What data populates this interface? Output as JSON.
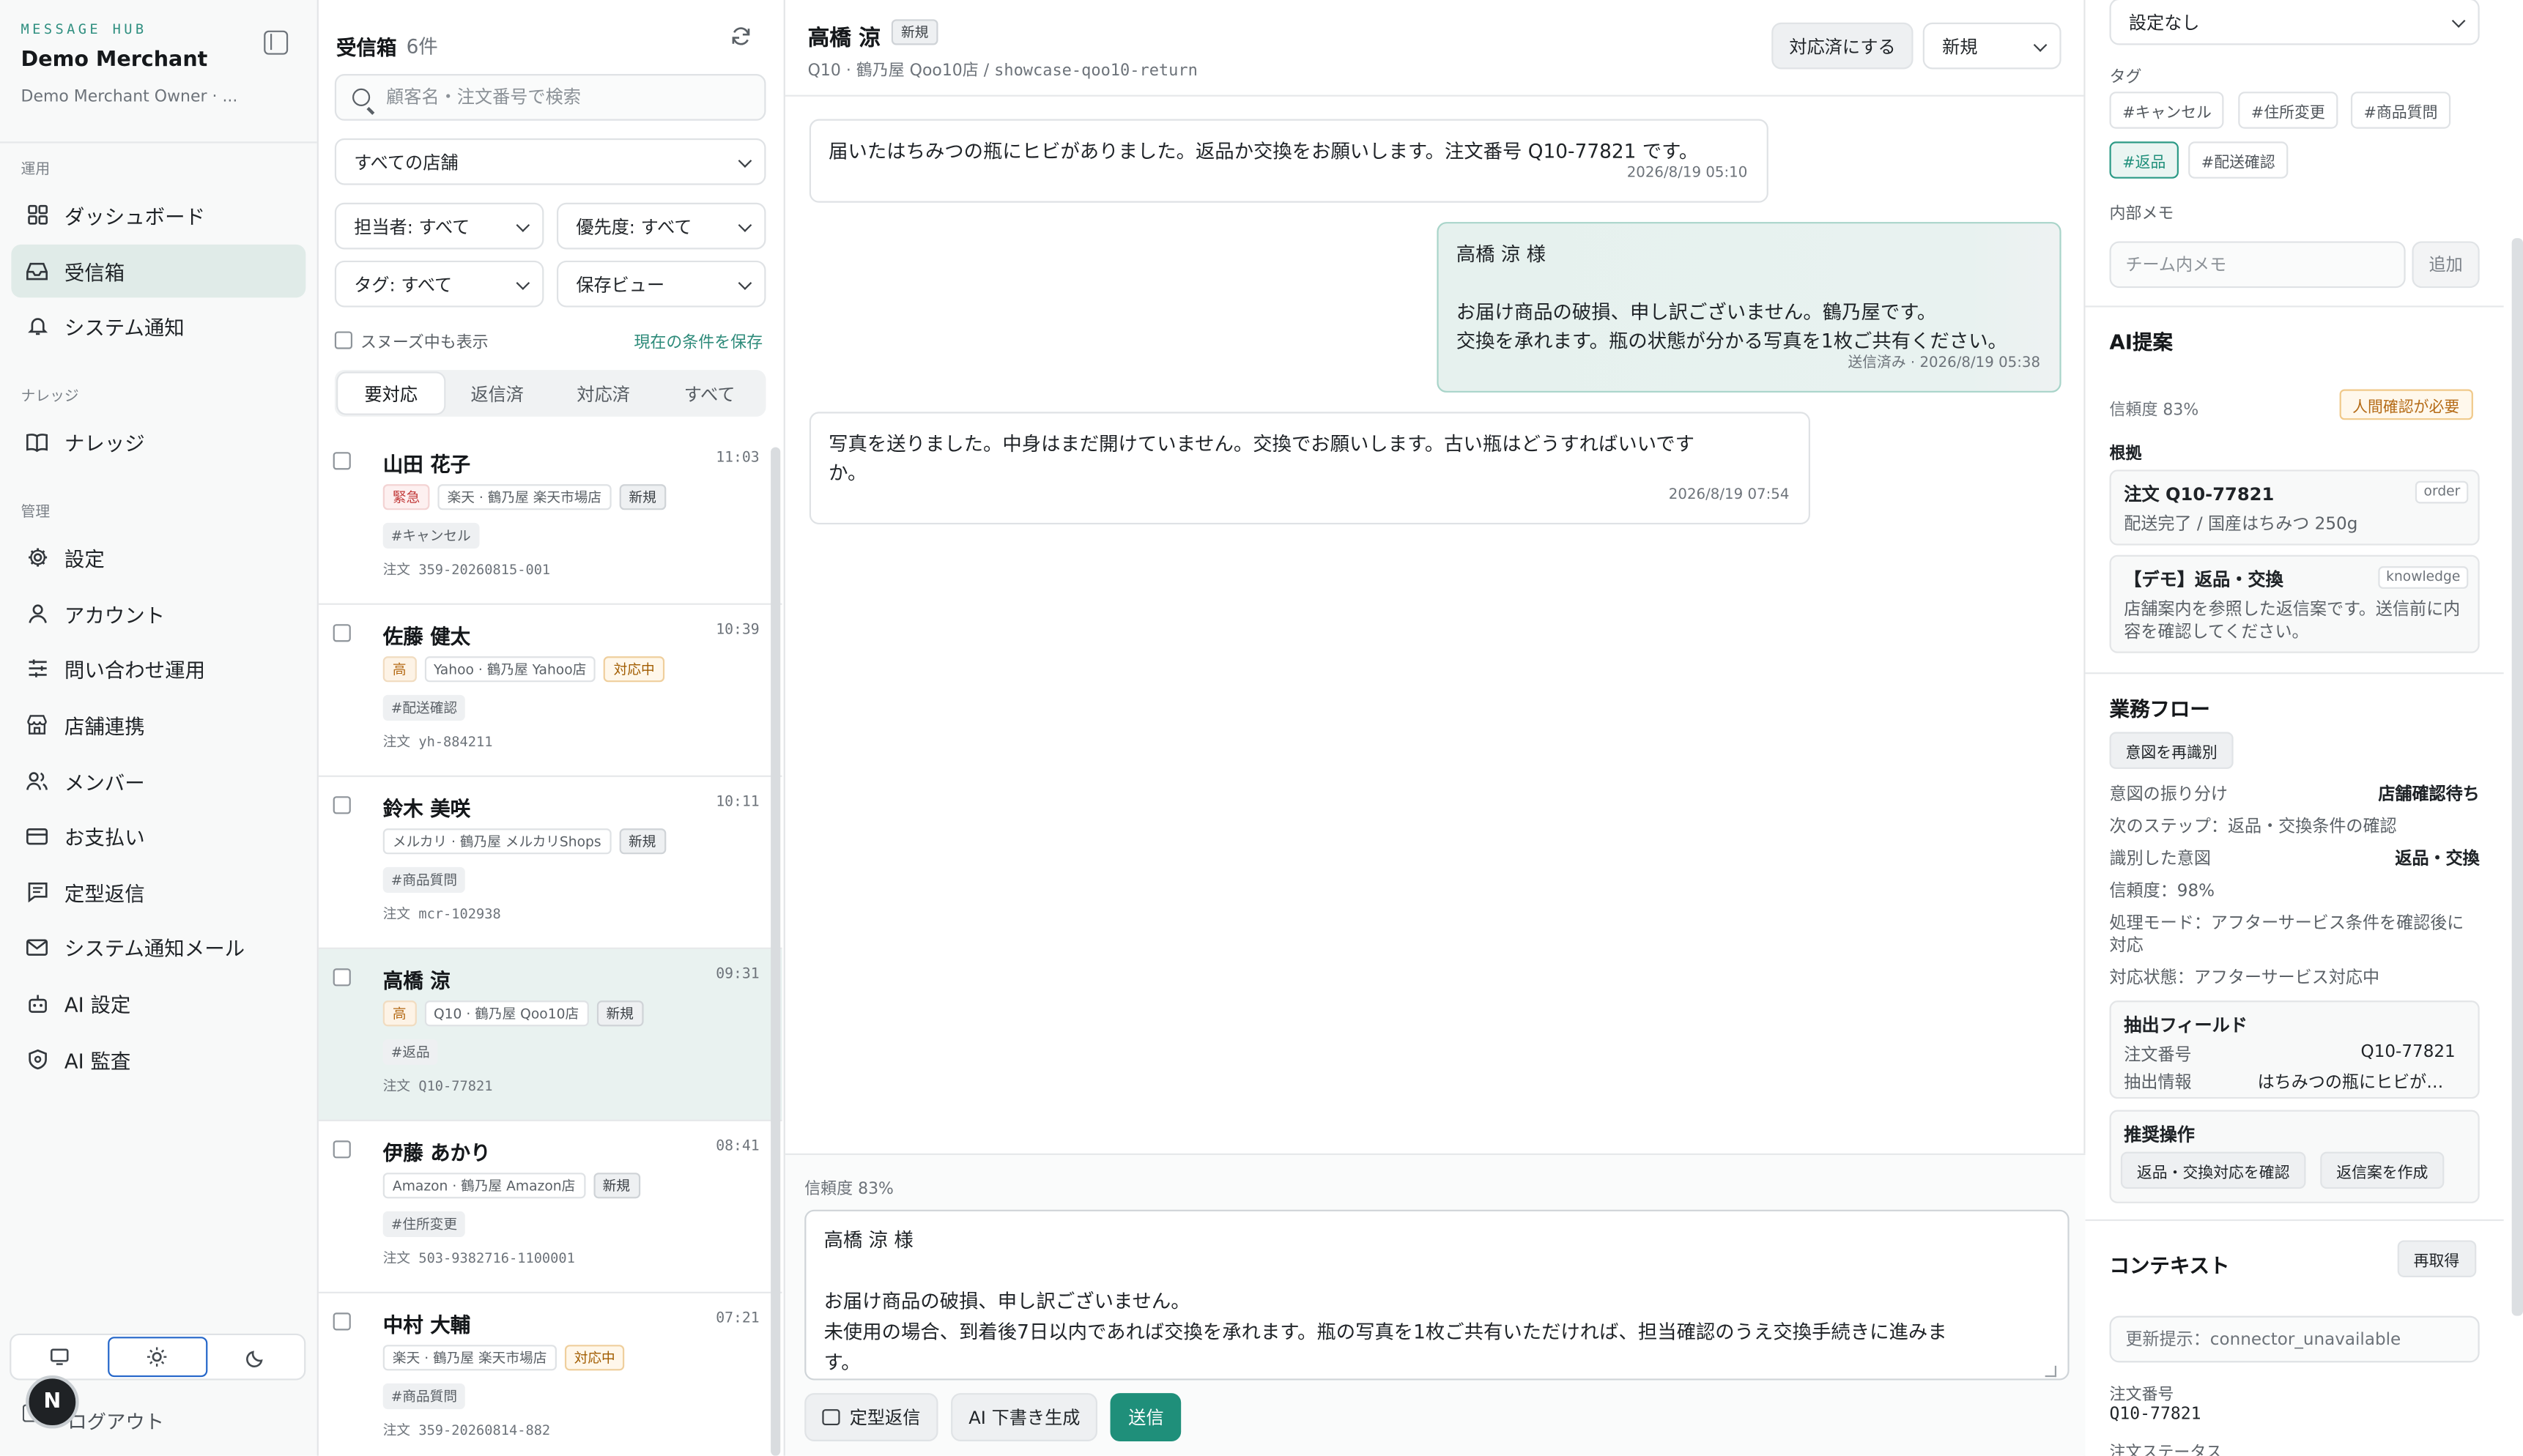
{
  "sidebar": {
    "hub_label": "MESSAGE HUB",
    "merchant": "Demo Merchant",
    "owner": "Demo Merchant Owner · ...",
    "sections": [
      {
        "title": "運用",
        "items": [
          {
            "label": "ダッシュボード",
            "icon": "grid-icon"
          },
          {
            "label": "受信箱",
            "icon": "inbox-icon",
            "active": true
          },
          {
            "label": "システム通知",
            "icon": "bell-icon"
          }
        ]
      },
      {
        "title": "ナレッジ",
        "items": [
          {
            "label": "ナレッジ",
            "icon": "book-icon"
          }
        ]
      },
      {
        "title": "管理",
        "items": [
          {
            "label": "設定",
            "icon": "gear-icon"
          },
          {
            "label": "アカウント",
            "icon": "user-icon"
          },
          {
            "label": "問い合わせ運用",
            "icon": "sliders-icon"
          },
          {
            "label": "店舗連携",
            "icon": "store-icon"
          },
          {
            "label": "メンバー",
            "icon": "users-icon"
          },
          {
            "label": "お支払い",
            "icon": "card-icon"
          },
          {
            "label": "定型返信",
            "icon": "message-icon"
          },
          {
            "label": "システム通知メール",
            "icon": "mail-icon"
          },
          {
            "label": "AI 設定",
            "icon": "robot-icon"
          },
          {
            "label": "AI 監査",
            "icon": "audit-icon"
          }
        ]
      }
    ],
    "avatar_initial": "N",
    "logout": "ログアウト"
  },
  "inbox": {
    "title": "受信箱",
    "count": "6件",
    "search_placeholder": "顧客名・注文番号で検索",
    "store_filter": "すべての店舗",
    "assignee_filter": "担当者: すべて",
    "priority_filter": "優先度: すべて",
    "tag_filter": "タグ: すべて",
    "saved_view": "保存ビュー",
    "show_snoozed": "スヌーズ中も表示",
    "save_condition": "現在の条件を保存",
    "tabs": [
      "要対応",
      "返信済",
      "対応済",
      "すべて"
    ],
    "conversations": [
      {
        "name": "山田 花子",
        "time": "11:03",
        "priority": "緊急",
        "priority_kind": "urgent",
        "store": "楽天 · 鶴乃屋 楽天市場店",
        "status": "新規",
        "status_kind": "new",
        "tag": "#キャンセル",
        "order": "注文 359-20260815-001"
      },
      {
        "name": "佐藤 健太",
        "time": "10:39",
        "priority": "高",
        "priority_kind": "high",
        "store": "Yahoo · 鶴乃屋 Yahoo店",
        "status": "対応中",
        "status_kind": "working",
        "tag": "#配送確認",
        "order": "注文 yh-884211"
      },
      {
        "name": "鈴木 美咲",
        "time": "10:11",
        "priority": "",
        "priority_kind": "",
        "store": "メルカリ · 鶴乃屋 メルカリShops",
        "status": "新規",
        "status_kind": "new",
        "tag": "#商品質問",
        "order": "注文 mcr-102938"
      },
      {
        "name": "高橋 涼",
        "time": "09:31",
        "priority": "高",
        "priority_kind": "high",
        "store": "Q10 · 鶴乃屋 Qoo10店",
        "status": "新規",
        "status_kind": "new",
        "tag": "#返品",
        "order": "注文 Q10-77821",
        "selected": true
      },
      {
        "name": "伊藤 あかり",
        "time": "08:41",
        "priority": "",
        "priority_kind": "",
        "store": "Amazon · 鶴乃屋 Amazon店",
        "status": "新規",
        "status_kind": "new",
        "tag": "#住所変更",
        "order": "注文 503-9382716-1100001"
      },
      {
        "name": "中村 大輔",
        "time": "07:21",
        "priority": "",
        "priority_kind": "",
        "store": "楽天 · 鶴乃屋 楽天市場店",
        "status": "対応中",
        "status_kind": "working",
        "tag": "#商品質問",
        "order": "注文 359-20260814-882"
      }
    ]
  },
  "conversation": {
    "customer": "高橋 涼",
    "badge": "新規",
    "meta_store": "Q10 · 鶴乃屋 Qoo10店 / ",
    "meta_id": "showcase-qoo10-return",
    "mark_done": "対応済にする",
    "status": "新規",
    "messages": [
      {
        "dir": "in",
        "text": "届いたはちみつの瓶にヒビがありました。返品か交換をお願いします。注文番号 Q10-77821 です。",
        "time": "2026/8/19 05:10"
      },
      {
        "dir": "out",
        "text": "高橋 涼 様\n\nお届け商品の破損、申し訳ございません。鶴乃屋です。\n交換を承れます。瓶の状態が分かる写真を1枚ご共有ください。",
        "time": "送信済み · 2026/8/19 05:38"
      },
      {
        "dir": "in",
        "text": "写真を送りました。中身はまだ開けていません。交換でお願いします。古い瓶はどうすればいいです\nか。",
        "time": "2026/8/19 07:54"
      }
    ],
    "composer_confidence": "信頼度 83%",
    "draft": "高橋 涼 様\n\nお届け商品の破損、申し訳ございません。\n未使用の場合、到着後7日以内であれば交換を承れます。瓶の写真を1枚ご共有いただければ、担当確認のうえ交換手続きに進みま\nす。",
    "btn_template": "定型返信",
    "btn_ai_draft": "AI 下書き生成",
    "btn_send": "送信"
  },
  "panel": {
    "setting_select": "設定なし",
    "tags_label": "タグ",
    "tags": [
      {
        "label": "#キャンセル",
        "on": false
      },
      {
        "label": "#住所変更",
        "on": false
      },
      {
        "label": "#商品質問",
        "on": false
      },
      {
        "label": "#返品",
        "on": true
      },
      {
        "label": "#配送確認",
        "on": false
      }
    ],
    "memo_label": "内部メモ",
    "memo_placeholder": "チーム内メモ",
    "memo_add": "追加",
    "ai_title": "AI提案",
    "ai_confidence": "信頼度 83%",
    "ai_warning": "人間確認が必要",
    "evidence_label": "根拠",
    "evidence": [
      {
        "title": "注文 Q10-77821",
        "sub": "配送完了 / 国産はちみつ 250g",
        "src": "order"
      },
      {
        "title": "【デモ】返品・交換",
        "sub": "店舗案内を参照した返信案です。送信前に内容を確認してください。",
        "src": "knowledge"
      }
    ],
    "flow_title": "業務フロー",
    "reclassify": "意図を再識別",
    "routing_label": "意図の振り分け",
    "routing_value": "店舗確認待ち",
    "next_step": "次のステップ：返品・交換条件の確認",
    "intent_label": "識別した意図",
    "intent_value": "返品・交換",
    "intent_confidence": "信頼度：98%",
    "mode": "処理モード：アフターサービス条件を確認後に対応",
    "state": "対応状態：アフターサービス対応中",
    "extracted_title": "抽出フィールド",
    "extracted": [
      {
        "k": "注文番号",
        "v": "Q10-77821"
      },
      {
        "k": "抽出情報",
        "v": "はちみつの瓶にヒビがあ..."
      }
    ],
    "actions_title": "推奨操作",
    "actions": [
      "返品・交換対応を確認",
      "返信案を作成"
    ],
    "context_title": "コンテキスト",
    "refetch": "再取得",
    "context_hint": "更新提示：connector_unavailable",
    "order_no_label": "注文番号",
    "order_no": "Q10-77821",
    "order_status_label": "注文ステータス"
  }
}
